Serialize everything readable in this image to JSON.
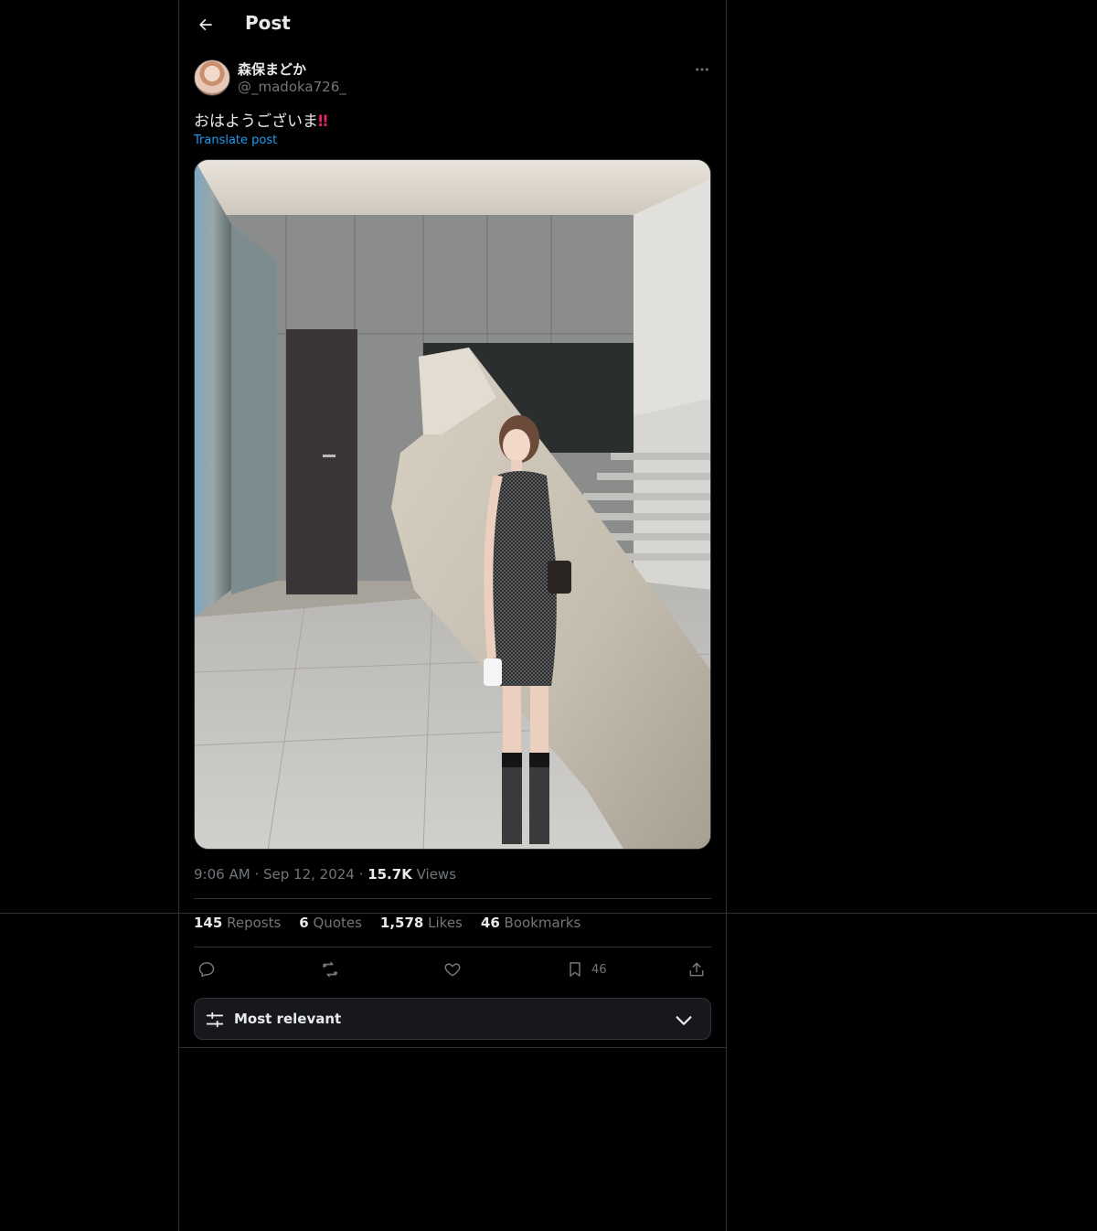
{
  "header": {
    "title": "Post"
  },
  "author": {
    "display_name": "森保まどか",
    "handle": "@_madoka726_"
  },
  "tweet": {
    "text": "おはようございま",
    "emoji": "‼",
    "translate_label": "Translate post"
  },
  "meta": {
    "time": "9:06 AM",
    "separator": "·",
    "date": "Sep 12, 2024",
    "views_count": "15.7K",
    "views_label": "Views"
  },
  "stats": {
    "reposts_count": "145",
    "reposts_label": "Reposts",
    "quotes_count": "6",
    "quotes_label": "Quotes",
    "likes_count": "1,578",
    "likes_label": "Likes",
    "bookmarks_count": "46",
    "bookmarks_label": "Bookmarks"
  },
  "actions": {
    "bookmark_count": "46"
  },
  "sort": {
    "label": "Most relevant"
  },
  "icons": [
    "back-arrow-icon",
    "more-icon",
    "reply-icon",
    "repost-icon",
    "like-icon",
    "bookmark-icon",
    "share-icon",
    "sort-sliders-icon",
    "chevron-down-icon"
  ],
  "colors": {
    "background": "#000000",
    "text": "#e7e9ea",
    "muted": "#71767b",
    "link": "#1d9bf0",
    "border": "#2f3336"
  }
}
